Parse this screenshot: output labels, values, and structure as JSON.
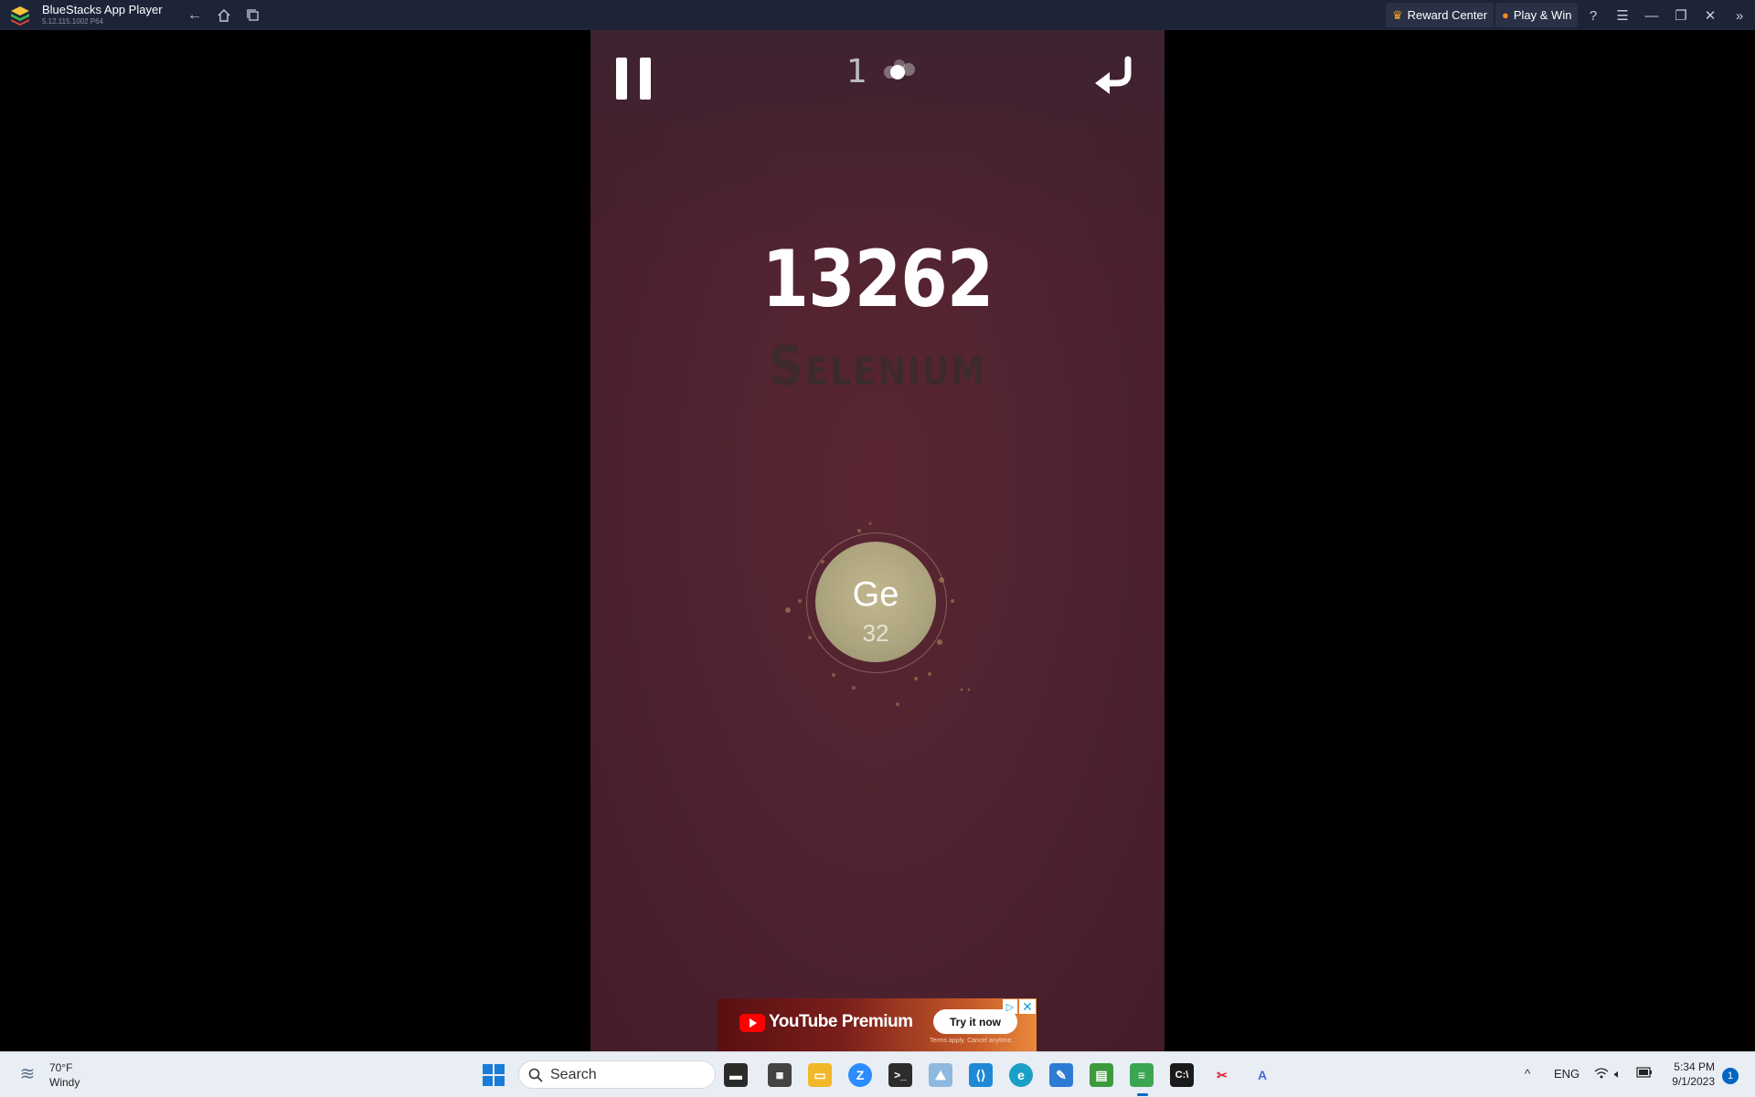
{
  "titlebar": {
    "app_title": "BlueStacks App Player",
    "version": "5.12.115.1002  P64",
    "reward_center": "Reward Center",
    "play_win": "Play & Win"
  },
  "game": {
    "orb_count": "1",
    "score": "13262",
    "element_name": "Selenium",
    "current_atom": {
      "symbol": "Ge",
      "number": "32"
    }
  },
  "ad": {
    "brand": "YouTube Premium",
    "cta": "Try it now",
    "fine_print": "Terms apply. Cancel anytime."
  },
  "taskbar": {
    "weather_temp": "70°F",
    "weather_desc": "Windy",
    "search_placeholder": "Search",
    "language": "ENG",
    "time": "5:34 PM",
    "date": "9/1/2023",
    "notification_count": "1"
  },
  "colors": {
    "titlebar_bg": "#1e2438",
    "game_bg": "#4e2230",
    "atom": "#aca47e",
    "taskbar_bg": "#e9eef5",
    "accent": "#0067c0"
  }
}
